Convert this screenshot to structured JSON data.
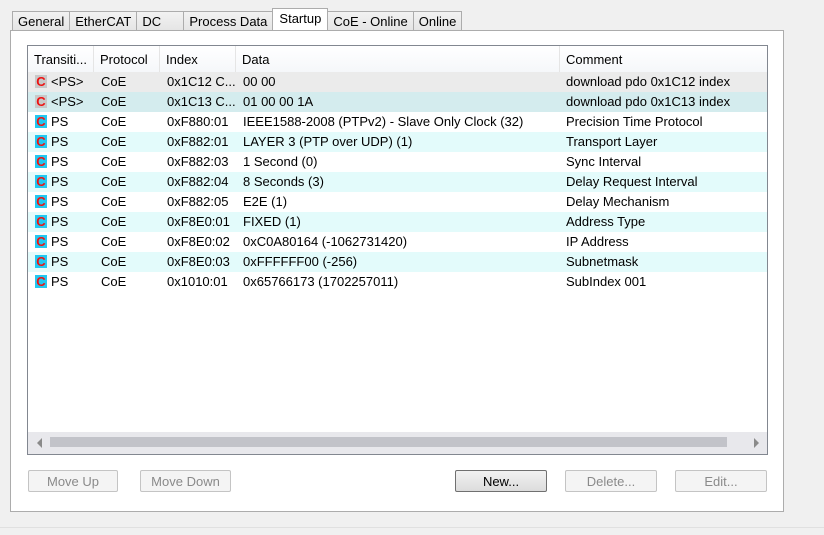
{
  "tabs": [
    {
      "label": "General",
      "active": false
    },
    {
      "label": "EtherCAT",
      "active": false
    },
    {
      "label": "DC",
      "active": false
    },
    {
      "label": "Process Data",
      "active": false
    },
    {
      "label": "Startup",
      "active": true
    },
    {
      "label": "CoE - Online",
      "active": false
    },
    {
      "label": "Online",
      "active": false
    }
  ],
  "table": {
    "columns": [
      "Transiti...",
      "Protocol",
      "Index",
      "Data",
      "Comment"
    ],
    "rows": [
      {
        "icon": "coe-fixed-icon",
        "transition": "<PS>",
        "protocol": "CoE",
        "index": "0x1C12 C...",
        "data": "00 00",
        "comment": "download pdo 0x1C12 index"
      },
      {
        "icon": "coe-fixed-icon",
        "transition": "<PS>",
        "protocol": "CoE",
        "index": "0x1C13 C...",
        "data": "01 00 00 1A",
        "comment": "download pdo 0x1C13 index"
      },
      {
        "icon": "coe-user-icon",
        "transition": "PS",
        "protocol": "CoE",
        "index": "0xF880:01",
        "data": "IEEE1588-2008 (PTPv2) - Slave Only Clock (32)",
        "comment": "Precision Time Protocol"
      },
      {
        "icon": "coe-user-icon",
        "transition": "PS",
        "protocol": "CoE",
        "index": "0xF882:01",
        "data": "LAYER 3 (PTP over UDP) (1)",
        "comment": "Transport Layer"
      },
      {
        "icon": "coe-user-icon",
        "transition": "PS",
        "protocol": "CoE",
        "index": "0xF882:03",
        "data": "1 Second (0)",
        "comment": "Sync Interval"
      },
      {
        "icon": "coe-user-icon",
        "transition": "PS",
        "protocol": "CoE",
        "index": "0xF882:04",
        "data": "8 Seconds (3)",
        "comment": "Delay Request Interval"
      },
      {
        "icon": "coe-user-icon",
        "transition": "PS",
        "protocol": "CoE",
        "index": "0xF882:05",
        "data": "E2E (1)",
        "comment": "Delay Mechanism"
      },
      {
        "icon": "coe-user-icon",
        "transition": "PS",
        "protocol": "CoE",
        "index": "0xF8E0:01",
        "data": "FIXED (1)",
        "comment": "Address Type"
      },
      {
        "icon": "coe-user-icon",
        "transition": "PS",
        "protocol": "CoE",
        "index": "0xF8E0:02",
        "data": "0xC0A80164 (-1062731420)",
        "comment": "IP Address"
      },
      {
        "icon": "coe-user-icon",
        "transition": "PS",
        "protocol": "CoE",
        "index": "0xF8E0:03",
        "data": "0xFFFFFF00 (-256)",
        "comment": "Subnetmask"
      },
      {
        "icon": "coe-user-icon",
        "transition": "PS",
        "protocol": "CoE",
        "index": "0x1010:01",
        "data": "0x65766173 (1702257011)",
        "comment": "SubIndex 001"
      }
    ]
  },
  "icon_glyph": "C",
  "buttons": {
    "move_up": "Move Up",
    "move_down": "Move Down",
    "new": "New...",
    "delete": "Delete...",
    "edit": "Edit..."
  },
  "colors": {
    "icon_letter": "#ee1111",
    "icon_fixed_bg": "#c8c8c8",
    "icon_user_bg": "#22c8f0",
    "row_selected_gray": "#ebebeb",
    "row_selected_teal": "#d4ecee",
    "row_alt": "#e3fbfb"
  }
}
